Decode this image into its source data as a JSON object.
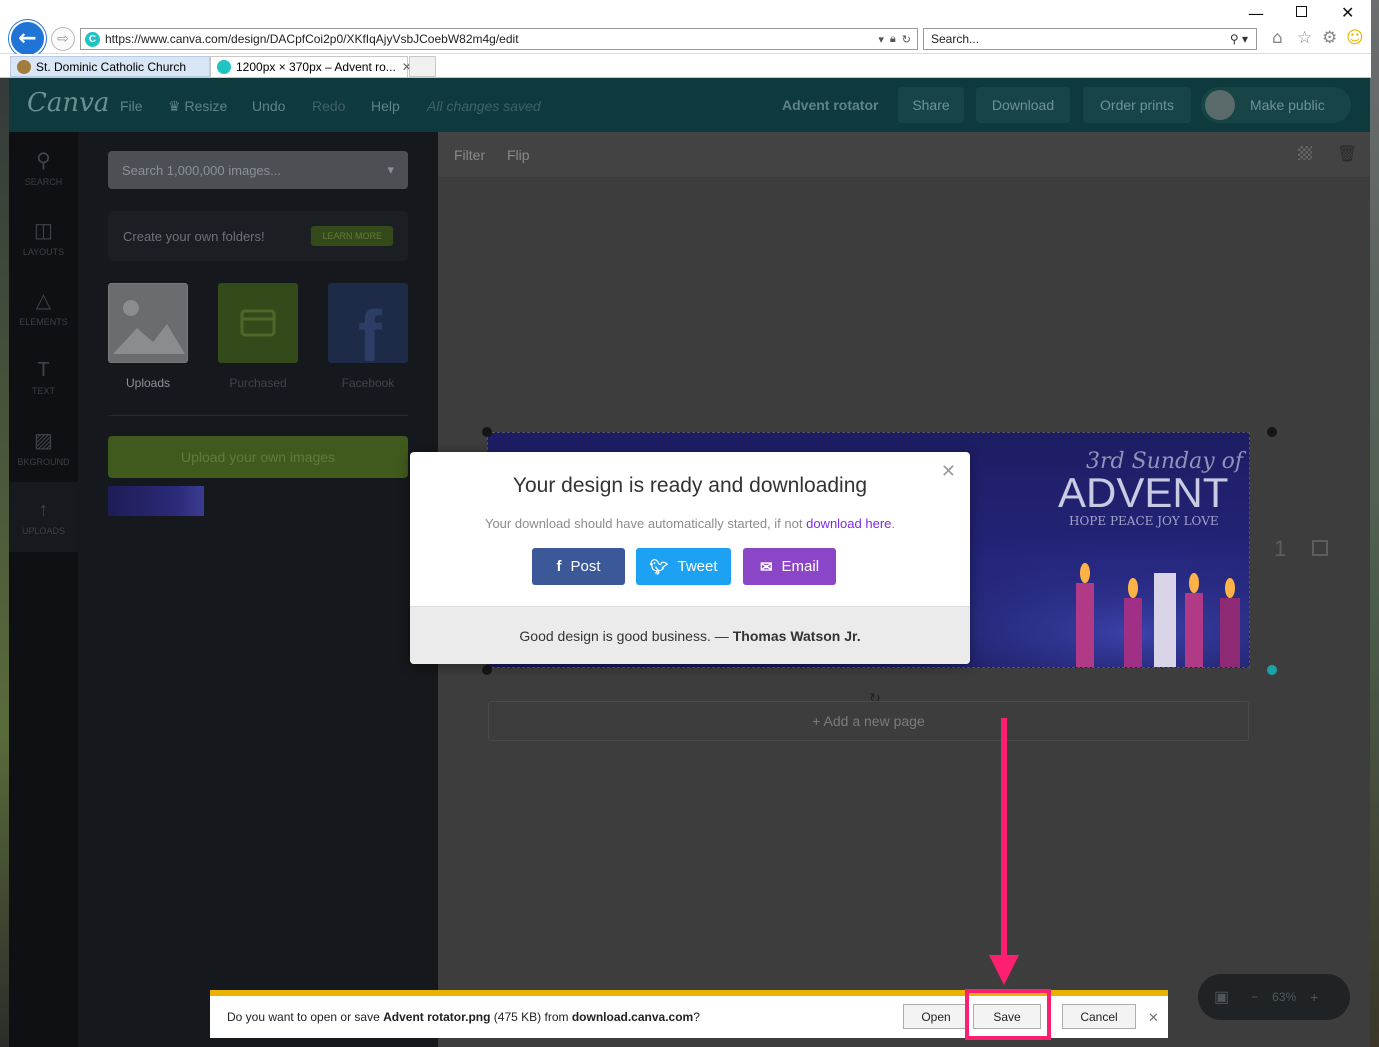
{
  "browser": {
    "url": "https://www.canva.com/design/DACpfCoi2p0/XKfIqAjyVsbJCoebW82m4g/edit",
    "search_placeholder": "Search...",
    "tabs": [
      {
        "label": "St. Dominic Catholic Church"
      },
      {
        "label": "1200px × 370px – Advent ro..."
      }
    ]
  },
  "toolbar": {
    "logo": "Canva",
    "menu": [
      "File",
      "Resize",
      "Undo",
      "Redo",
      "Help"
    ],
    "status": "All changes saved",
    "design_name": "Advent rotator",
    "share": "Share",
    "download": "Download",
    "order_prints": "Order prints",
    "make_public": "Make public"
  },
  "rail": [
    {
      "label": "SEARCH",
      "icon": "search-icon"
    },
    {
      "label": "LAYOUTS",
      "icon": "layouts-icon"
    },
    {
      "label": "ELEMENTS",
      "icon": "elements-icon"
    },
    {
      "label": "TEXT",
      "icon": "text-icon"
    },
    {
      "label": "BKGROUND",
      "icon": "background-icon"
    },
    {
      "label": "UPLOADS",
      "icon": "upload-icon"
    }
  ],
  "side_panel": {
    "search_placeholder": "Search 1,000,000 images...",
    "folders_text": "Create your own folders!",
    "learn_more": "LEARN MORE",
    "tiles": [
      "Uploads",
      "Purchased",
      "Facebook"
    ],
    "upload_button": "Upload your own images"
  },
  "editor": {
    "tools": [
      "Filter",
      "Flip"
    ],
    "add_page": "+ Add a new page",
    "page_number": "1",
    "zoom": "63%"
  },
  "design": {
    "line1": "3rd Sunday of",
    "line2": "ADVENT",
    "line3": "HOPE  PEACE  JOY  LOVE"
  },
  "modal": {
    "title": "Your design is ready and downloading",
    "subtitle": "Your download should have automatically started, if not",
    "subtitle_link": "download here",
    "post": "Post",
    "tweet": "Tweet",
    "email": "Email",
    "quote": "Good design is good business. —",
    "quote_author": "Thomas Watson Jr."
  },
  "download_bar": {
    "prefix": "Do you want to open or save",
    "file": "Advent rotator.png",
    "size": "(475 KB) from",
    "source": "download.canva.com",
    "suffix": "?",
    "open": "Open",
    "save": "Save",
    "cancel": "Cancel"
  },
  "colors": {
    "accent_highlight": "#ff1f71",
    "facebook": "#3b5998",
    "twitter": "#1da1f2",
    "email": "#8a46c6",
    "canva_topbar": "#0f3a3d"
  }
}
